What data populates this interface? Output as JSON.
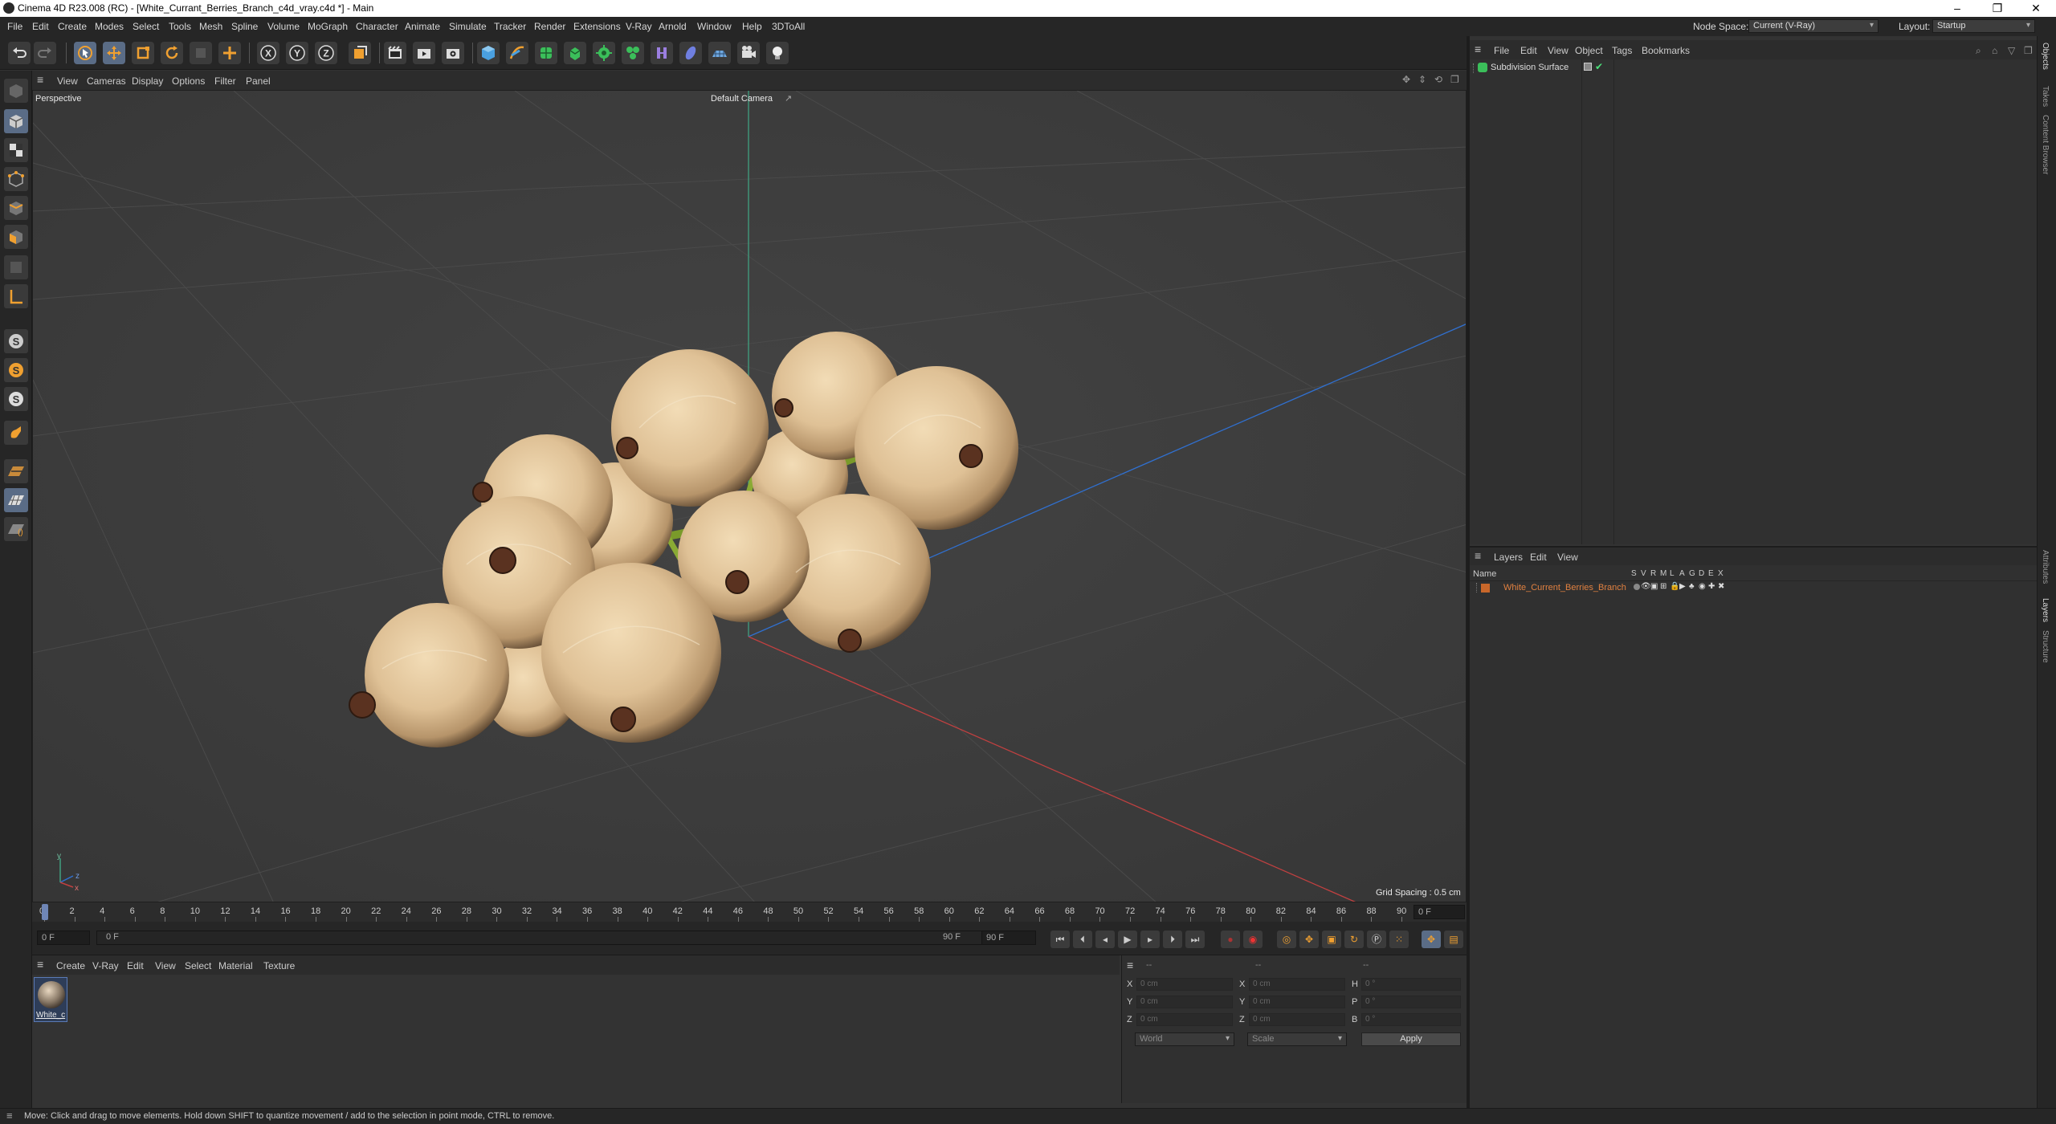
{
  "window": {
    "title": "Cinema 4D R23.008 (RC) - [White_Currant_Berries_Branch_c4d_vray.c4d *] - Main",
    "minimize": "–",
    "maximize": "❐",
    "close": "✕"
  },
  "menubar": {
    "items": [
      "File",
      "Edit",
      "Create",
      "Modes",
      "Select",
      "Tools",
      "Mesh",
      "Spline",
      "Volume",
      "MoGraph",
      "Character",
      "Animate",
      "Simulate",
      "Tracker",
      "Render",
      "Extensions",
      "V-Ray",
      "Arnold",
      "Window",
      "Help",
      "3DToAll"
    ],
    "node_space_label": "Node Space:",
    "node_space_value": "Current (V-Ray)",
    "layout_label": "Layout:",
    "layout_value": "Startup"
  },
  "viewport": {
    "menu": [
      "View",
      "Cameras",
      "Display",
      "Options",
      "Filter",
      "Panel"
    ],
    "projection": "Perspective",
    "camera": "Default Camera",
    "grid_spacing": "Grid Spacing : 0.5 cm",
    "axis_y": "y",
    "axis_z": "z",
    "axis_x": "x"
  },
  "timeline": {
    "ticks": [
      "0",
      "2",
      "4",
      "6",
      "8",
      "10",
      "12",
      "14",
      "16",
      "18",
      "20",
      "22",
      "24",
      "26",
      "28",
      "30",
      "32",
      "34",
      "36",
      "38",
      "40",
      "42",
      "44",
      "46",
      "48",
      "50",
      "52",
      "54",
      "56",
      "58",
      "60",
      "62",
      "64",
      "66",
      "68",
      "70",
      "72",
      "74",
      "76",
      "78",
      "80",
      "82",
      "84",
      "86",
      "88",
      "90"
    ],
    "current_frame_field": "0 F",
    "start_field": "0 F",
    "range_start": "0 F",
    "range_end": "90 F",
    "end_field": "90 F"
  },
  "material_manager": {
    "menu": [
      "Create",
      "V-Ray",
      "Edit",
      "View",
      "Select",
      "Material",
      "Texture"
    ],
    "materials": [
      {
        "label": "White_c"
      }
    ]
  },
  "coordinates": {
    "header_dashes": [
      "--",
      "--",
      "--"
    ],
    "rows": [
      {
        "pos_label": "X",
        "pos_val": "0 cm",
        "size_label": "X",
        "size_val": "0 cm",
        "rot_label": "H",
        "rot_val": "0 °"
      },
      {
        "pos_label": "Y",
        "pos_val": "0 cm",
        "size_label": "Y",
        "size_val": "0 cm",
        "rot_label": "P",
        "rot_val": "0 °"
      },
      {
        "pos_label": "Z",
        "pos_val": "0 cm",
        "size_label": "Z",
        "size_val": "0 cm",
        "rot_label": "B",
        "rot_val": "0 °"
      }
    ],
    "space_select": "World",
    "mode_select": "Scale",
    "apply_label": "Apply"
  },
  "object_manager": {
    "menu": [
      "File",
      "Edit",
      "View",
      "Object",
      "Tags",
      "Bookmarks"
    ],
    "objects": [
      {
        "name": "Subdivision Surface"
      }
    ]
  },
  "layer_manager": {
    "menu": [
      "Layers",
      "Edit",
      "View"
    ],
    "col_name": "Name",
    "col_flags": [
      "S",
      "V",
      "R",
      "M",
      "L",
      "A",
      "G",
      "D",
      "E",
      "X"
    ],
    "layers": [
      {
        "name": "White_Current_Berries_Branch",
        "color": "#c8672a"
      }
    ]
  },
  "side_tabs": [
    "Objects",
    "Takes",
    "Content Browser",
    "Attributes",
    "Layers",
    "Structure"
  ],
  "status": {
    "text": "Move: Click and drag to move elements. Hold down SHIFT to quantize movement / add to the selection in point mode, CTRL to remove."
  },
  "colors": {
    "accent": "#f0a030",
    "axis_x": "#c04040",
    "axis_y": "#40a080",
    "axis_z": "#3070d0",
    "layer_text": "#e08040",
    "selected_tool": "#5a6c86"
  }
}
